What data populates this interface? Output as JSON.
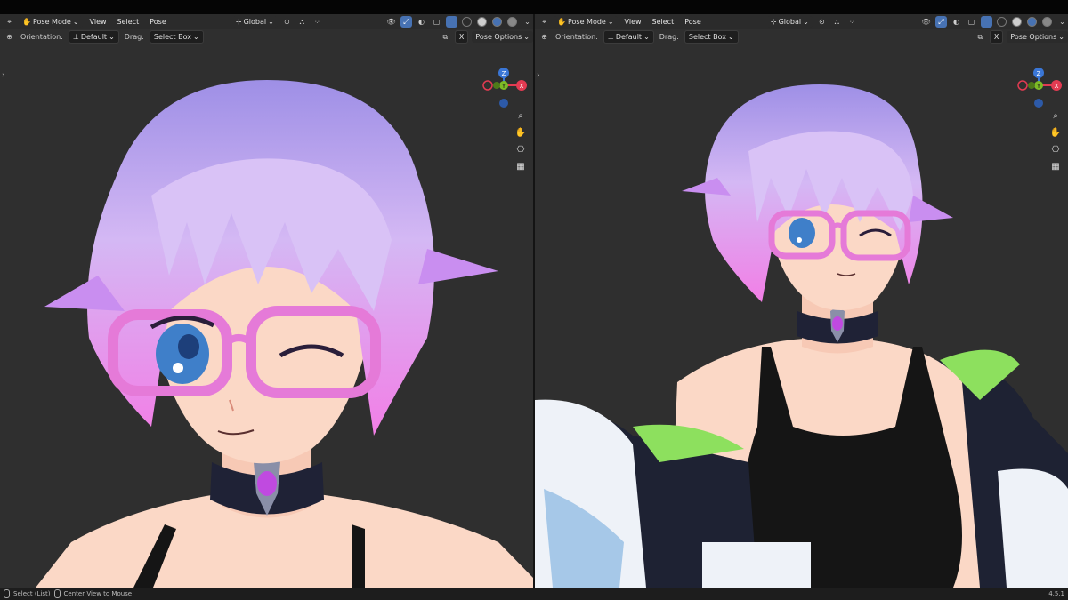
{
  "header": {
    "mode": "Pose Mode",
    "menus": [
      "View",
      "Select",
      "Pose"
    ],
    "transform_orientation": "Global",
    "orientation_label": "Orientation:",
    "orientation_value": "Default",
    "drag_label": "Drag:",
    "drag_value": "Select Box",
    "x_label": "X",
    "pose_options": "Pose Options"
  },
  "gizmo": {
    "axes": [
      "Z",
      "Y",
      "X"
    ],
    "colors": {
      "x": "#e33b52",
      "y": "#7dbb26",
      "z": "#3a76d6",
      "neg": "#8a2a38"
    }
  },
  "status_bar": {
    "select": "Select (List)",
    "center": "Center View to Mouse",
    "version": "4.5.1"
  },
  "colors": {
    "viewport_bg": "#2f2f2f",
    "header_bg": "#2b2b2b",
    "accent": "#4772b3",
    "hair_top": "#b7a8f0",
    "hair_bottom": "#f08ce8",
    "glasses": "#e57ad8",
    "eye": "#3f7fc9",
    "skin": "#fbd8c6",
    "choker": "#1f2236",
    "gem": "#c04ae0",
    "top": "#151515",
    "jacket_white": "#eef2f8",
    "jacket_blue": "#a6c8e8",
    "jacket_green": "#8de05e",
    "jacket_dark": "#1e2233"
  }
}
